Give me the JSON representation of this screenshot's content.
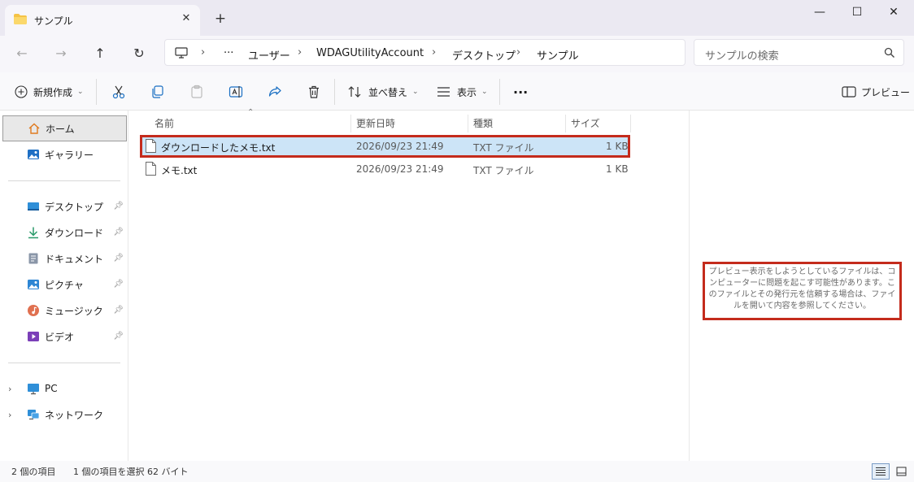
{
  "tab": {
    "title": "サンプル",
    "close": "✕",
    "new_tab": "+"
  },
  "window": {
    "minimize": "—",
    "maximize": "☐",
    "close": "✕"
  },
  "nav": {
    "back": "←",
    "forward": "→",
    "up": "↑",
    "refresh": "↻"
  },
  "address": {
    "more": "···",
    "path": [
      "ユーザー",
      "WDAGUtilityAccount",
      "デスクトップ",
      "サンプル"
    ]
  },
  "search": {
    "placeholder": "サンプルの検索"
  },
  "toolbar": {
    "new_label": "新規作成",
    "sort_label": "並べ替え",
    "view_label": "表示",
    "more": "···",
    "preview_label": "プレビュー"
  },
  "sidebar": {
    "home": "ホーム",
    "gallery": "ギャラリー",
    "pinned": [
      "デスクトップ",
      "ダウンロード",
      "ドキュメント",
      "ピクチャ",
      "ミュージック",
      "ビデオ"
    ],
    "pc": "PC",
    "network": "ネットワーク"
  },
  "columns": {
    "name": "名前",
    "date": "更新日時",
    "type": "種類",
    "size": "サイズ"
  },
  "files": [
    {
      "name": "ダウンロードしたメモ.txt",
      "date": "2026/09/23 21:49",
      "type": "TXT ファイル",
      "size": "1 KB"
    },
    {
      "name": "メモ.txt",
      "date": "2026/09/23 21:49",
      "type": "TXT ファイル",
      "size": "1 KB"
    }
  ],
  "preview": {
    "message": "プレビュー表示をしようとしているファイルは、コンピューターに問題を起こす可能性があります。このファイルとその発行元を信頼する場合は、ファイルを開いて内容を参照してください。"
  },
  "status": {
    "count": "2 個の項目",
    "selection": "1 個の項目を選択  62 バイト"
  },
  "colors": {
    "selection": "#cce4f7",
    "highlight_border": "#c42b1c",
    "folder": "#f5c346"
  }
}
